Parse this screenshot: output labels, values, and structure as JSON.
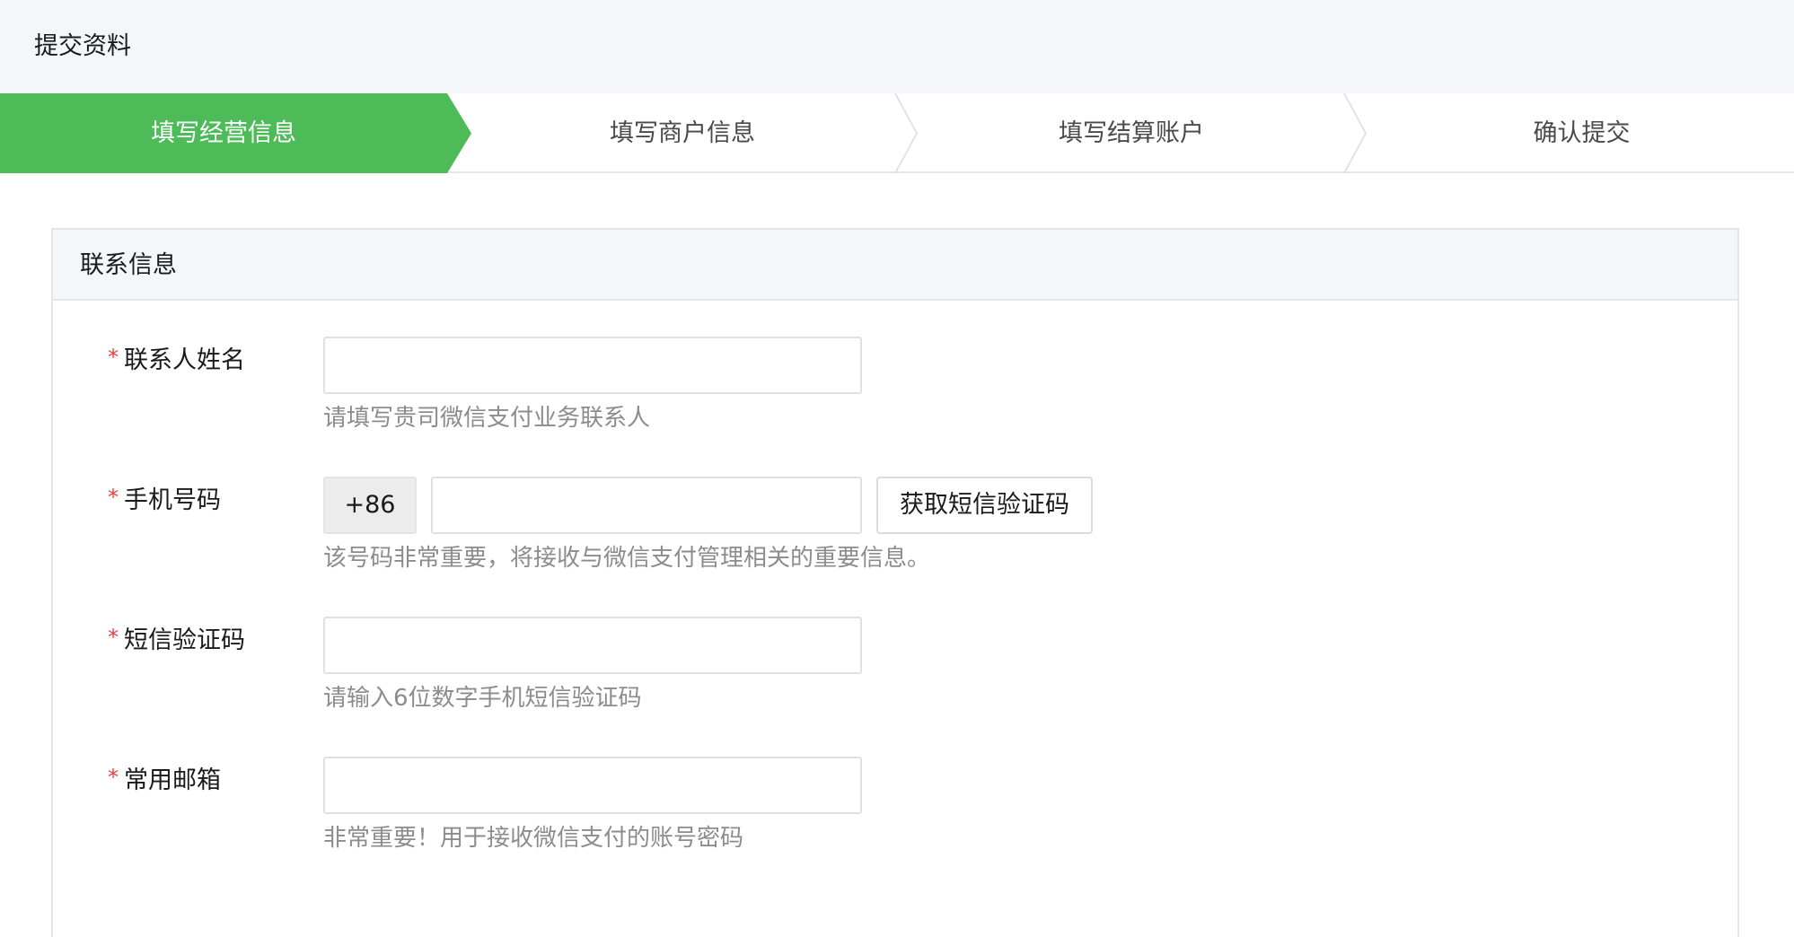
{
  "header": {
    "title": "提交资料"
  },
  "steps": [
    {
      "label": "填写经营信息",
      "active": true
    },
    {
      "label": "填写商户信息",
      "active": false
    },
    {
      "label": "填写结算账户",
      "active": false
    },
    {
      "label": "确认提交",
      "active": false
    }
  ],
  "colors": {
    "accent": "#4dbb58",
    "required": "#e64340",
    "hint": "#8c8c8c"
  },
  "section": {
    "title": "联系信息",
    "fields": {
      "contact_name": {
        "required_mark": "*",
        "label": "联系人姓名",
        "value": "",
        "hint": "请填写贵司微信支付业务联系人"
      },
      "phone": {
        "required_mark": "*",
        "label": "手机号码",
        "prefix": "+86",
        "value": "",
        "button_label": "获取短信验证码",
        "hint": "该号码非常重要，将接收与微信支付管理相关的重要信息。"
      },
      "sms_code": {
        "required_mark": "*",
        "label": "短信验证码",
        "value": "",
        "hint": "请输入6位数字手机短信验证码"
      },
      "email": {
        "required_mark": "*",
        "label": "常用邮箱",
        "value": "",
        "hint": "非常重要！用于接收微信支付的账号密码"
      }
    }
  }
}
